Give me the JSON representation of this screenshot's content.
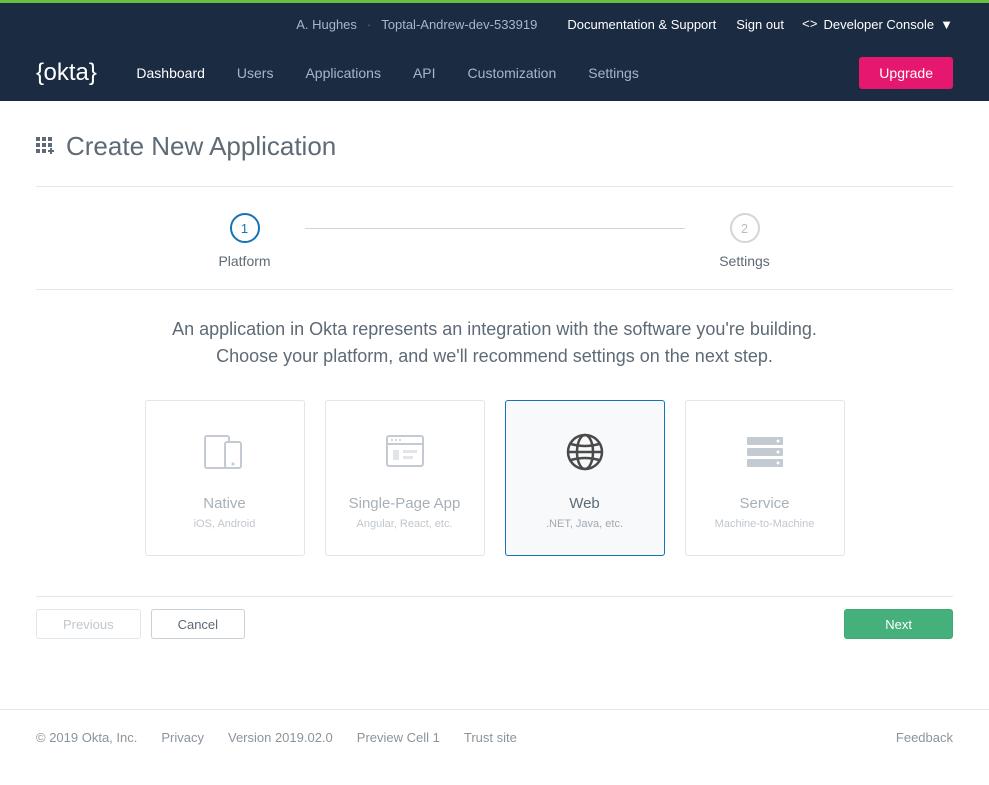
{
  "topbar": {
    "user": "A. Hughes",
    "org": "Toptal-Andrew-dev-533919",
    "console": "Developer Console",
    "docs": "Documentation & Support",
    "signout": "Sign out"
  },
  "nav": {
    "dashboard": "Dashboard",
    "users": "Users",
    "applications": "Applications",
    "api": "API",
    "customization": "Customization",
    "settings": "Settings",
    "upgrade": "Upgrade"
  },
  "page": {
    "title": "Create New Application",
    "desc_line1": "An application in Okta represents an integration with the software you're building.",
    "desc_line2": "Choose your platform, and we'll recommend settings on the next step."
  },
  "steps": [
    {
      "num": "1",
      "label": "Platform",
      "active": true
    },
    {
      "num": "2",
      "label": "Settings",
      "active": false
    }
  ],
  "platforms": [
    {
      "key": "native",
      "title": "Native",
      "sub": "iOS, Android",
      "selected": false
    },
    {
      "key": "spa",
      "title": "Single-Page App",
      "sub": "Angular, React, etc.",
      "selected": false
    },
    {
      "key": "web",
      "title": "Web",
      "sub": ".NET, Java, etc.",
      "selected": true
    },
    {
      "key": "service",
      "title": "Service",
      "sub": "Machine-to-Machine",
      "selected": false
    }
  ],
  "actions": {
    "previous": "Previous",
    "cancel": "Cancel",
    "next": "Next"
  },
  "footer": {
    "copyright": "© 2019 Okta, Inc.",
    "privacy": "Privacy",
    "version": "Version 2019.02.0",
    "preview": "Preview Cell 1",
    "trust": "Trust site",
    "feedback": "Feedback"
  }
}
